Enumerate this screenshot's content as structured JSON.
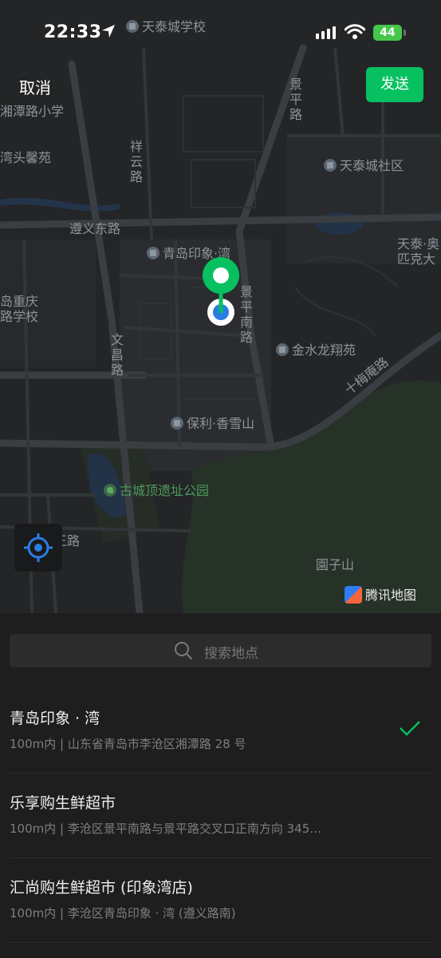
{
  "status_bar": {
    "time": "22:33",
    "battery": "44"
  },
  "header": {
    "cancel_label": "取消",
    "send_label": "发送"
  },
  "map": {
    "labels": {
      "tiantaicheng_school": "天泰城学校",
      "xiangtan_school": "湘潭路小学",
      "wantouxinyuan": "湾头馨苑",
      "jingping_road": "景平路",
      "xiangyun_road": "祥云路",
      "tiantaicheng_community": "天泰城社区",
      "zunyi_east_road": "遵义东路",
      "qingdao_yinxiangwan": "青岛印象·湾",
      "tiantai_olympic": "天泰·奥匹克大",
      "chongqing_school": "岛重庆路学校",
      "jingping_south_road": "景平南路",
      "jinshuilong": "金水龙翔苑",
      "wenchang_road": "文昌路",
      "shimeian_road": "十梅庵路",
      "baoli_xiangxueshan": "保利·香雪山",
      "guchengding_park": "古城顶遗址公园",
      "road_stub": "王路",
      "yuanzishan": "園子山"
    },
    "brand": "腾讯地图"
  },
  "search": {
    "placeholder": "搜索地点"
  },
  "results": [
    {
      "title": "青岛印象 · 湾",
      "subtitle": "100m内 | 山东省青岛市李沧区湘潭路 28 号",
      "selected": true
    },
    {
      "title": "乐享购生鲜超市",
      "subtitle": "100m内 | 李沧区景平南路与景平路交叉口正南方向 345…",
      "selected": false
    },
    {
      "title": "汇尚购生鲜超市 (印象湾店)",
      "subtitle": "100m内 | 李沧区青岛印象 · 湾 (遵义路南)",
      "selected": false
    }
  ],
  "colors": {
    "accent": "#07c160",
    "pin_blue": "#2a7de1",
    "map_bg": "#232527"
  }
}
